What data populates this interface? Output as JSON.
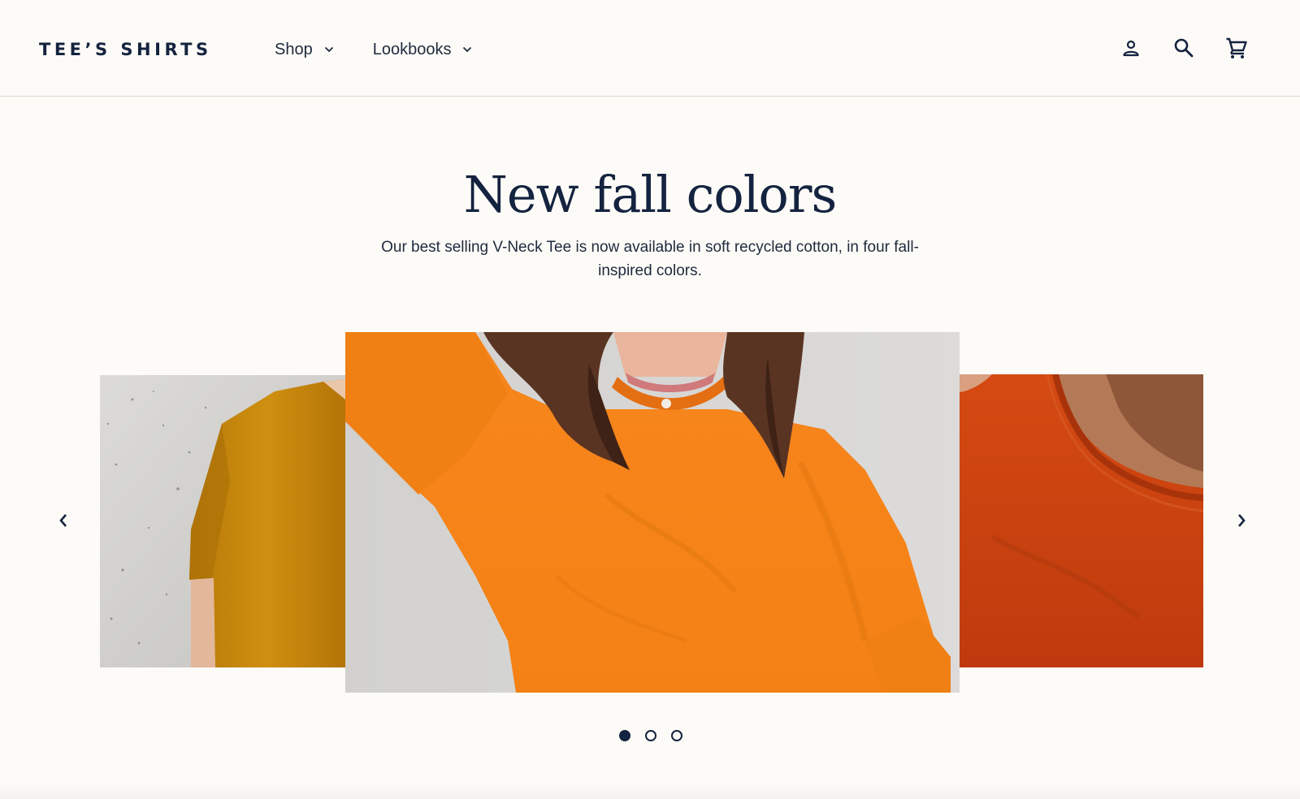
{
  "brand": {
    "name": "TEE’S SHIRTS"
  },
  "nav": {
    "items": [
      {
        "label": "Shop",
        "icon": "chevron-down-icon"
      },
      {
        "label": "Lookbooks",
        "icon": "chevron-down-icon"
      }
    ]
  },
  "header_icons": [
    "account-icon",
    "search-icon",
    "cart-icon"
  ],
  "hero": {
    "title": "New fall colors",
    "subtitle": "Our best selling V-Neck Tee is now available in soft recycled cotton, in four fall-inspired colors."
  },
  "carousel": {
    "slides": [
      {
        "position": "previous",
        "shirt_color": "#c98a0c"
      },
      {
        "position": "current",
        "shirt_color": "#f7861e"
      },
      {
        "position": "next",
        "shirt_color": "#c7410e"
      }
    ],
    "prev_icon": "chevron-left-icon",
    "next_icon": "chevron-right-icon",
    "dots_total": 3,
    "active_dot": 1
  },
  "colors": {
    "background": "#fdfbf7",
    "ink": "#14233f",
    "border": "#dedad3"
  }
}
